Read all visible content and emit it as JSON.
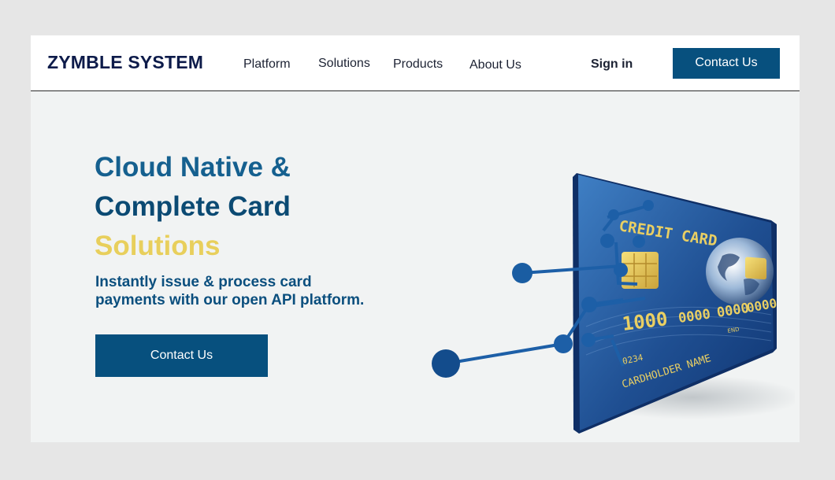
{
  "header": {
    "logo": "ZYMBLE SYSTEM",
    "nav": [
      "Platform",
      "Solutions",
      "Products",
      "About Us"
    ],
    "sign_in": "Sign in",
    "cta": "Contact Us"
  },
  "hero": {
    "title_line1": "Cloud Native &",
    "title_line2": "Complete Card",
    "title_line3": "Solutions",
    "subtitle_line1": "Instantly issue & process card",
    "subtitle_line2": "payments with our open API platform.",
    "cta": "Contact Us"
  },
  "card_image": {
    "heading": "CREDIT CARD",
    "number": [
      "1000",
      "0000",
      "0000",
      "0000"
    ],
    "small_digits": "0234",
    "holder": "CARDHOLDER NAME",
    "end_label": "END"
  },
  "colors": {
    "brand_dark": "#07507e",
    "title_blue": "#15608f",
    "accent_gold": "#e8cf5c",
    "logo_navy": "#0d1b4a",
    "page_bg": "#f1f3f3",
    "outer_bg": "#e6e6e6"
  }
}
